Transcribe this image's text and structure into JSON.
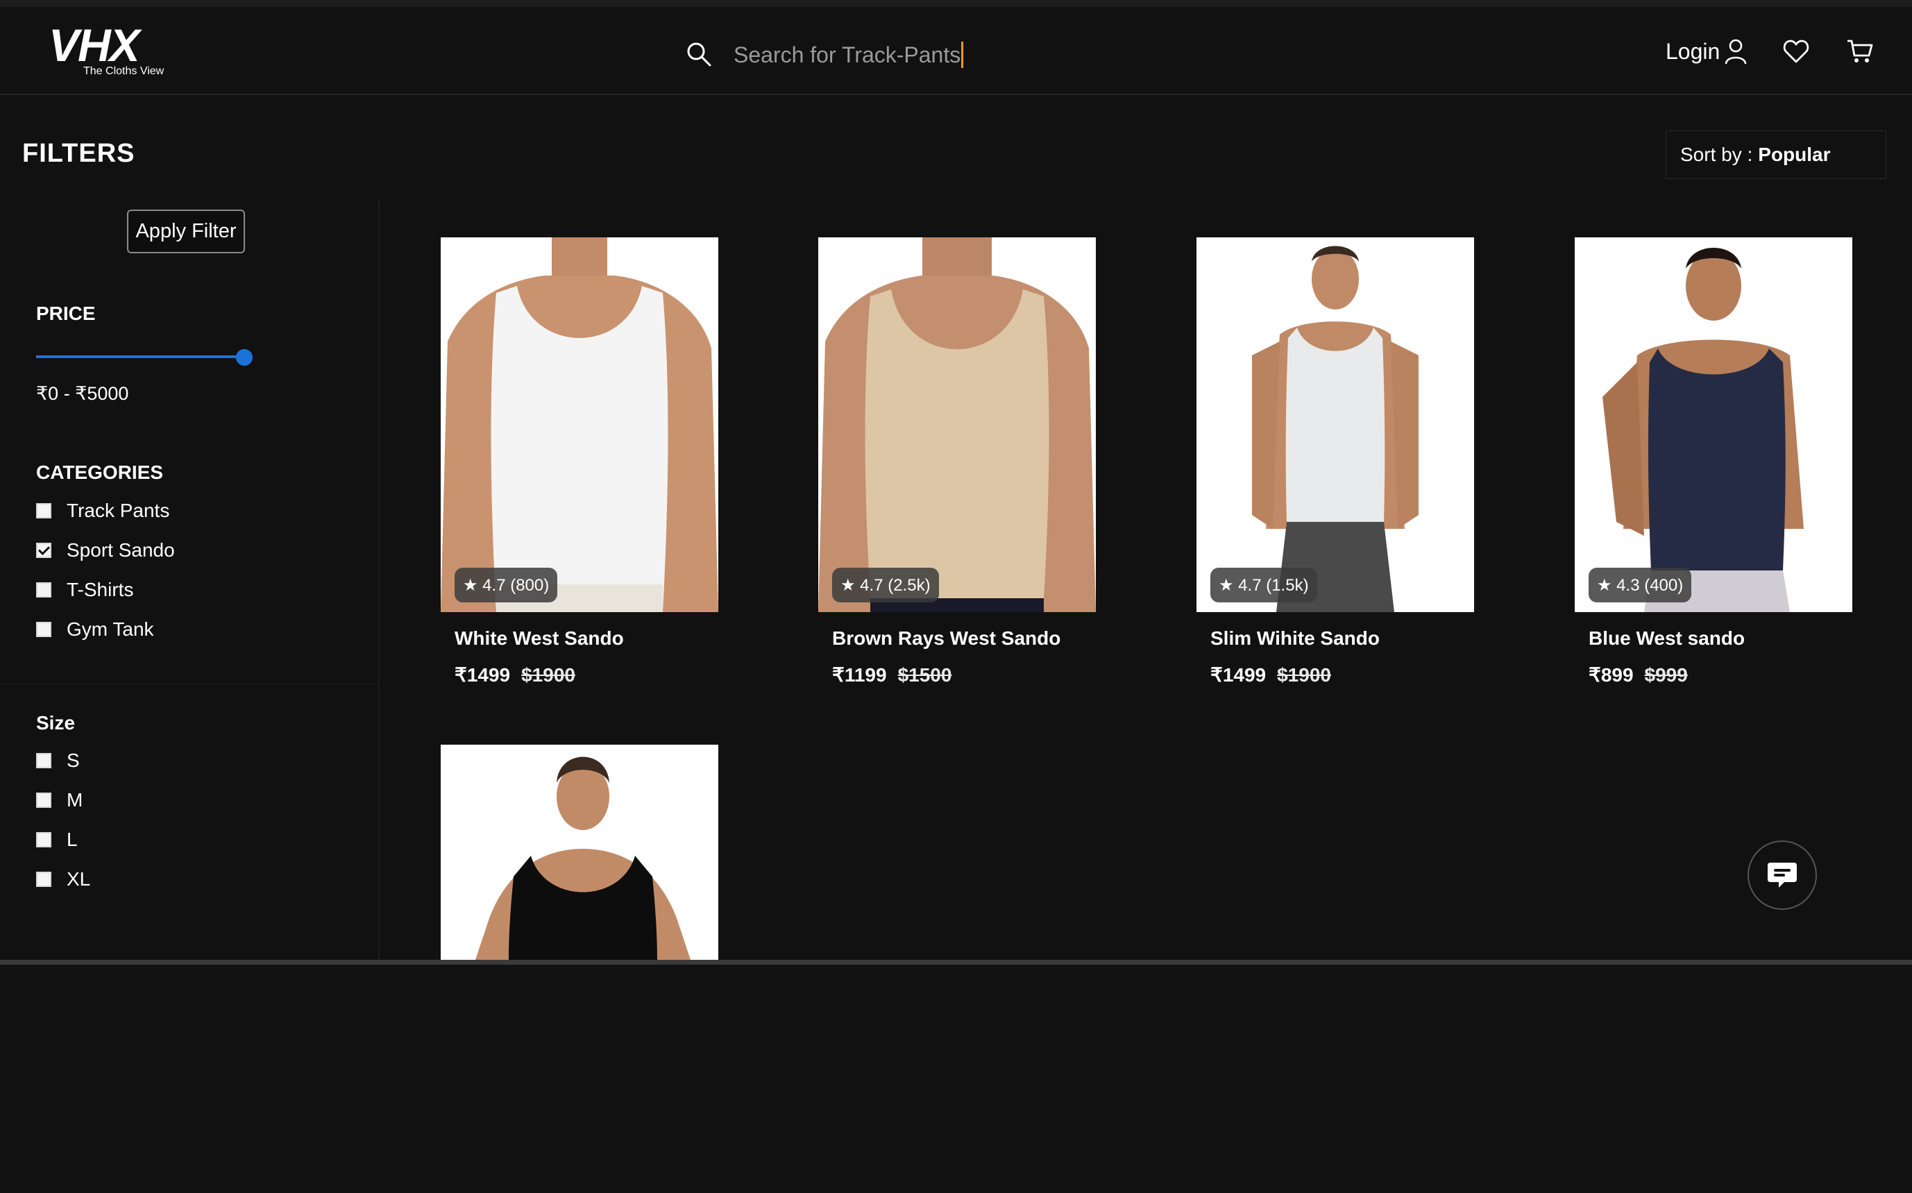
{
  "header": {
    "logo_text": "VHX",
    "logo_tagline": "The Cloths View",
    "search_placeholder": "Search for Track-Pants",
    "login_label": "Login"
  },
  "toolbar": {
    "filters_title": "FILTERS",
    "sort_label": "Sort by :",
    "sort_value": "Popular"
  },
  "sidebar": {
    "apply_label": "Apply Filter",
    "price_title": "PRICE",
    "price_range": "₹0 - ₹5000",
    "price_slider_fraction": 1.0,
    "categories_title": "CATEGORIES",
    "categories": [
      {
        "label": "Track Pants",
        "checked": false
      },
      {
        "label": "Sport Sando",
        "checked": true
      },
      {
        "label": "T-Shirts",
        "checked": false
      },
      {
        "label": "Gym Tank",
        "checked": false
      }
    ],
    "size_title": "Size",
    "sizes": [
      {
        "label": "S",
        "checked": false
      },
      {
        "label": "M",
        "checked": false
      },
      {
        "label": "L",
        "checked": false
      },
      {
        "label": "XL",
        "checked": false
      }
    ]
  },
  "products": [
    {
      "name": "White West Sando",
      "price": "₹1499",
      "old_price": "$1900",
      "rating": "★ 4.7 (800)",
      "shirt_color": "#f4f4f4"
    },
    {
      "name": "Brown Rays West Sando",
      "price": "₹1199",
      "old_price": "$1500",
      "rating": "★ 4.7 (2.5k)",
      "shirt_color": "#dcc6a6"
    },
    {
      "name": "Slim Wihite Sando",
      "price": "₹1499",
      "old_price": "$1900",
      "rating": "★ 4.7 (1.5k)",
      "shirt_color": "#e9eaec"
    },
    {
      "name": "Blue West sando",
      "price": "₹899",
      "old_price": "$999",
      "rating": "★ 4.3 (400)",
      "shirt_color": "#262b45"
    },
    {
      "name": "",
      "price": "",
      "old_price": "",
      "rating": "",
      "shirt_color": "#0d0d0d"
    }
  ],
  "colors": {
    "background": "#111111",
    "accent": "#1a73d9",
    "caret": "#ff9b00"
  }
}
